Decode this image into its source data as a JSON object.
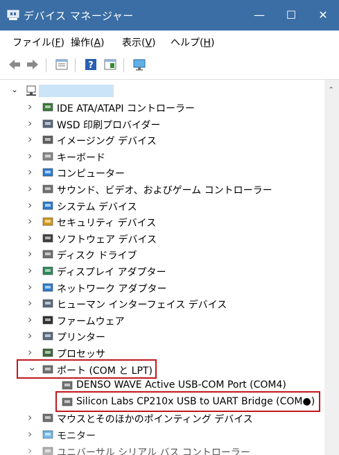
{
  "window": {
    "title": "デバイス マネージャー",
    "minimize": "—",
    "maximize": "☐",
    "close": "✕",
    "accent": "#3a6ea5"
  },
  "menu": [
    {
      "label": "ファイル(",
      "key": "F",
      "end": ")"
    },
    {
      "label": "操作(",
      "key": "A",
      "end": ")"
    },
    {
      "label": "表示(",
      "key": "V",
      "end": ")"
    },
    {
      "label": "ヘルプ(",
      "key": "H",
      "end": ")"
    }
  ],
  "toolbar": {
    "icons": [
      "back-arrow-icon",
      "forward-arrow-icon",
      "properties-icon",
      "help-icon",
      "update-driver-icon",
      "scan-monitor-icon"
    ]
  },
  "tree": {
    "root": {
      "label": ""
    },
    "categories": [
      {
        "label": "IDE ATA/ATAPI コントローラー",
        "icon": "ide-controller-icon"
      },
      {
        "label": "WSD 印刷プロバイダー",
        "icon": "printer-icon"
      },
      {
        "label": "イメージング デバイス",
        "icon": "camera-icon"
      },
      {
        "label": "キーボード",
        "icon": "keyboard-icon"
      },
      {
        "label": "コンピューター",
        "icon": "computer-icon"
      },
      {
        "label": "サウンド、ビデオ、およびゲーム コントローラー",
        "icon": "speaker-icon"
      },
      {
        "label": "システム デバイス",
        "icon": "system-folder-icon"
      },
      {
        "label": "セキュリティ デバイス",
        "icon": "security-key-icon"
      },
      {
        "label": "ソフトウェア デバイス",
        "icon": "software-device-icon"
      },
      {
        "label": "ディスク ドライブ",
        "icon": "disk-drive-icon"
      },
      {
        "label": "ディスプレイ アダプター",
        "icon": "display-adapter-icon"
      },
      {
        "label": "ネットワーク アダプター",
        "icon": "network-adapter-icon"
      },
      {
        "label": "ヒューマン インターフェイス デバイス",
        "icon": "hid-icon"
      },
      {
        "label": "ファームウェア",
        "icon": "firmware-icon"
      },
      {
        "label": "プリンター",
        "icon": "printer-icon"
      },
      {
        "label": "プロセッサ",
        "icon": "processor-icon"
      }
    ],
    "ports": {
      "label": "ポート (COM と LPT)",
      "children": [
        {
          "label": "DENSO WAVE Active USB-COM Port (COM4)"
        },
        {
          "label": "Silicon Labs CP210x USB to UART Bridge (COM●)"
        }
      ]
    },
    "after": [
      {
        "label": "マウスとそのほかのポインティング デバイス",
        "icon": "mouse-icon"
      },
      {
        "label": "モニター",
        "icon": "monitor-icon"
      },
      {
        "label": "ユニバーサル シリアル バス コントローラー",
        "icon": "usb-controller-icon"
      }
    ]
  },
  "highlight_color": "#c0171d"
}
